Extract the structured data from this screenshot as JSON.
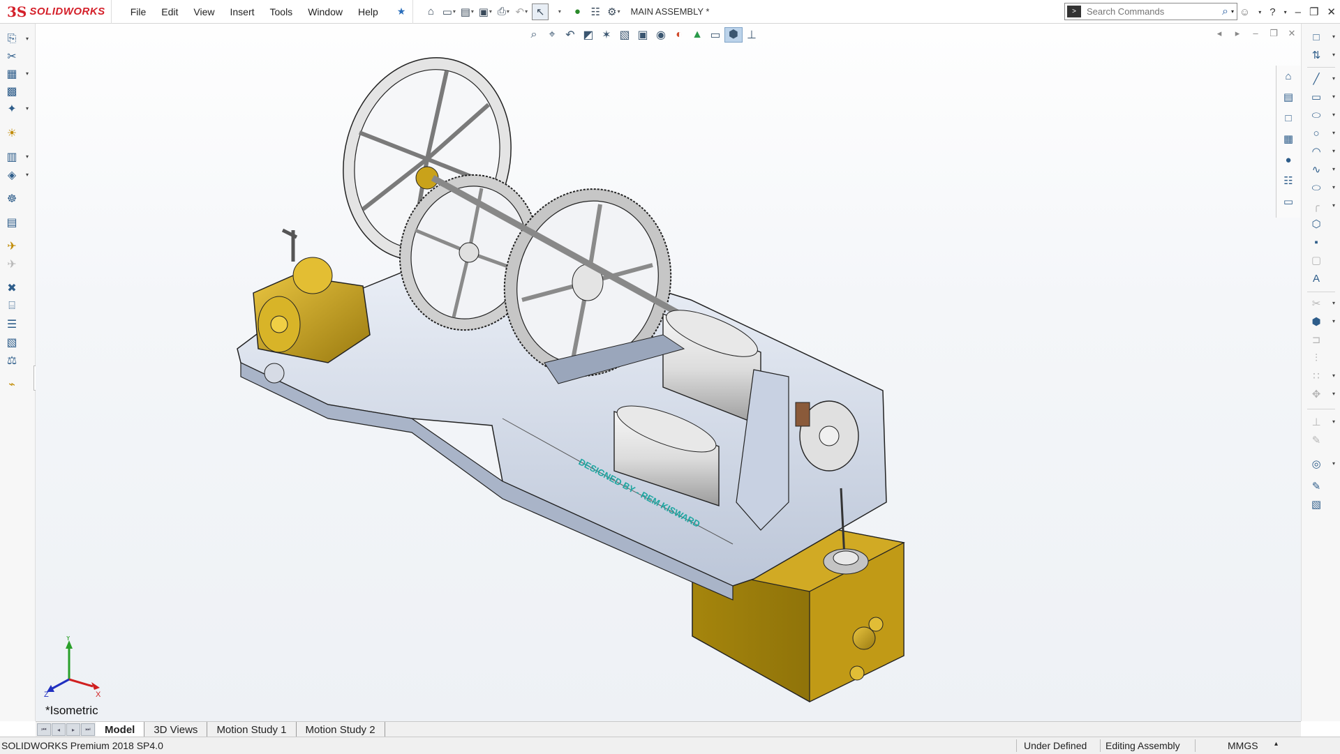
{
  "app": {
    "brand_ds": "3S",
    "brand_name": "SOLIDWORKS",
    "document_title": "MAIN ASSEMBLY *"
  },
  "menu": [
    "File",
    "Edit",
    "View",
    "Insert",
    "Tools",
    "Window",
    "Help"
  ],
  "search": {
    "placeholder": "Search Commands"
  },
  "viewport": {
    "view_name": "*Isometric"
  },
  "triad": {
    "x": "X",
    "y": "Y",
    "z": "Z"
  },
  "engraving": "DESIGNED BY - REM KISWARD",
  "tabs": [
    {
      "label": "Model",
      "active": true
    },
    {
      "label": "3D Views",
      "active": false
    },
    {
      "label": "Motion Study 1",
      "active": false
    },
    {
      "label": "Motion Study 2",
      "active": false
    }
  ],
  "status": {
    "product": "SOLIDWORKS Premium 2018 SP4.0",
    "state": "Under Defined",
    "mode": "Editing Assembly",
    "units": "MMGS"
  },
  "colors": {
    "brand": "#d4202a",
    "base_metal": "#cdd6e6",
    "brass": "#c9a21a",
    "accent": "#2a6ebb"
  }
}
